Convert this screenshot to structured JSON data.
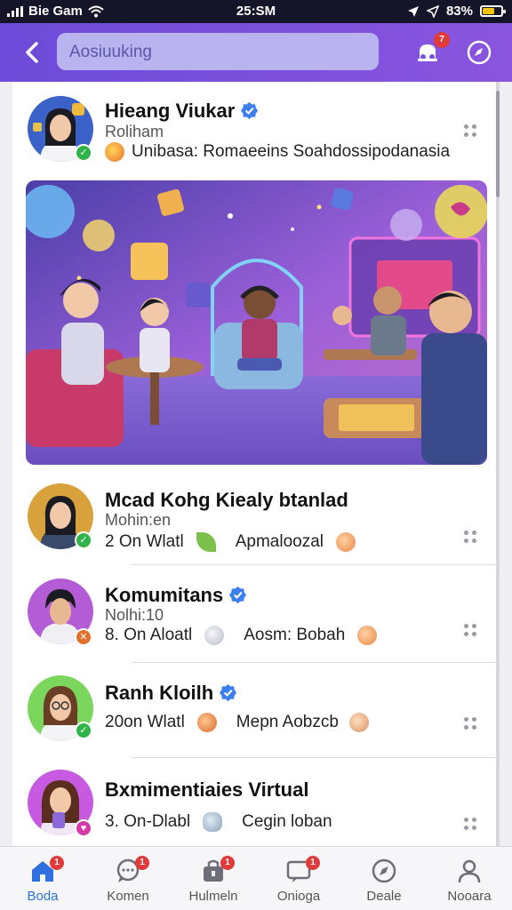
{
  "status_bar": {
    "carrier": "Bie Gam",
    "time": "25:SM",
    "battery": "83%"
  },
  "header": {
    "search_placeholder": "Aosiuuking",
    "notification_count": "7",
    "icons": [
      "back-icon",
      "notification-icon",
      "compass-icon"
    ]
  },
  "feed": {
    "featured": {
      "name": "Hieang Viukar",
      "subtitle": "Roliham",
      "description": "Unibasa: Romaeeins Soahdossipodanasia",
      "image_alt": "people gathering in a neon virtual lounge"
    },
    "posts": [
      {
        "name": "Mcad Kohg Kiealy btanlad",
        "subtitle": "Mohin:en",
        "count": "2",
        "meta": "On Wlatl",
        "reaction": "Apmaloozal",
        "verified": false,
        "badge_color": "#2fb34a",
        "avatar_bg": "#d9a13c"
      },
      {
        "name": "Komumitans",
        "subtitle": "Nolhi:10",
        "count": "8.",
        "meta": "On Aloatl",
        "reaction": "Aosm: Bobah",
        "verified": true,
        "badge_color": "#e0702a",
        "avatar_bg": "#b45cd6"
      },
      {
        "name": "Ranh Kloilh",
        "subtitle": "",
        "count": "20on",
        "meta": "Wlatl",
        "reaction": "Mepn Aobzcb",
        "verified": true,
        "badge_color": "#2fb34a",
        "avatar_bg": "#7ad65c"
      },
      {
        "name": "Bxmimentiaies Virtual",
        "subtitle": "",
        "count": "3.",
        "meta": "On-Dlabl",
        "reaction": "Cegin loban",
        "verified": false,
        "badge_color": "#d63aa8",
        "avatar_bg": "#c75ae0"
      }
    ]
  },
  "bottom_nav": {
    "items": [
      {
        "label": "Boda",
        "icon": "home-icon",
        "badge": "1",
        "active": true
      },
      {
        "label": "Komen",
        "icon": "chat-icon",
        "badge": "1",
        "active": false
      },
      {
        "label": "Hulmeln",
        "icon": "store-icon",
        "badge": "1",
        "active": false
      },
      {
        "label": "Onioga",
        "icon": "message-icon",
        "badge": "1",
        "active": false
      },
      {
        "label": "Deale",
        "icon": "explore-icon",
        "badge": "",
        "active": false
      },
      {
        "label": "Nooara",
        "icon": "profile-icon",
        "badge": "",
        "active": false
      }
    ]
  },
  "colors": {
    "header_start": "#6c4bd8",
    "header_end": "#8a55de",
    "verified": "#3b7ff0",
    "badge": "#e23a3a",
    "active_nav": "#2f6fe0"
  }
}
